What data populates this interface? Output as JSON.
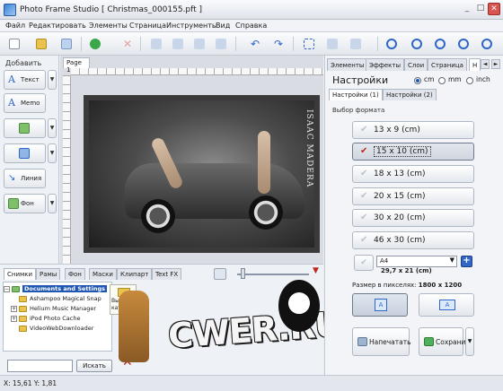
{
  "window": {
    "title": "Photo Frame Studio [ Christmas_000155.pft ]",
    "minimize": "_",
    "maximize": "□",
    "close": "✕"
  },
  "menu": [
    "Файл",
    "Редактировать",
    "Элементы",
    "Страница",
    "Инструменты",
    "Вид",
    "Справка"
  ],
  "left_panel": {
    "heading": "Добавить",
    "tools": [
      {
        "label": "Текст",
        "icon": "text-icon"
      },
      {
        "label": "Memo",
        "icon": "memo-icon"
      },
      {
        "label": "",
        "icon": "image-icon"
      },
      {
        "label": "",
        "icon": "shape-icon"
      },
      {
        "label": "Линия",
        "icon": "line-icon"
      },
      {
        "label": "Фон",
        "icon": "background-icon"
      }
    ]
  },
  "canvas": {
    "page_tab": "Page 1",
    "photo_caption": "ISAAC MADERA"
  },
  "bottom_panel": {
    "tabs": [
      "Снимки",
      "Рамы",
      "Фон",
      "Маски",
      "Клипарт",
      "Text FX"
    ],
    "tree": [
      {
        "label": "Documents and Settings",
        "selected": true,
        "expand": "−"
      },
      {
        "label": "Ashampoo Magical Snap",
        "selected": false,
        "expand": ""
      },
      {
        "label": "Helium Music Manager",
        "selected": false,
        "expand": "+"
      },
      {
        "label": "iPod Photo Cache",
        "selected": false,
        "expand": "+"
      },
      {
        "label": "VideoWebDownloader",
        "selected": false,
        "expand": ""
      }
    ],
    "folder_tile": "Выбрать каталог",
    "search_placeholder": "",
    "search_button": "Искать"
  },
  "right_panel": {
    "tabs": [
      "Элементы",
      "Эффекты",
      "Слои",
      "Страница",
      "Н"
    ],
    "nav_prev": "◄",
    "nav_next": "►",
    "title": "Настройки",
    "units": [
      {
        "label": "cm",
        "checked": true
      },
      {
        "label": "mm",
        "checked": false
      },
      {
        "label": "inch",
        "checked": false
      }
    ],
    "sub_tabs": [
      "Настройки (1)",
      "Настройки (2)"
    ],
    "format_label": "Выбор формата",
    "formats": [
      {
        "label": "13 x 9 (cm)",
        "selected": false
      },
      {
        "label": "15 x 10 (cm)",
        "selected": true
      },
      {
        "label": "18 x 13 (cm)",
        "selected": false
      },
      {
        "label": "20 x 15 (cm)",
        "selected": false
      },
      {
        "label": "30 x 20 (cm)",
        "selected": false
      },
      {
        "label": "46 x 30 (cm)",
        "selected": false
      }
    ],
    "paper_select": "A4",
    "paper_dims": "29,7 x 21 (cm)",
    "pixel_size_label": "Размер в пикселях:",
    "pixel_size_value": "1800 x 1200",
    "print_button": "Напечатать",
    "save_button": "Сохранить"
  },
  "status": {
    "coords": "X: 15,61 Y: 1,81"
  },
  "watermark": {
    "text": "CWER.RU"
  },
  "colors": {
    "accent": "#1f56b3",
    "danger": "#c0241d",
    "panel": "#eef1f5"
  }
}
